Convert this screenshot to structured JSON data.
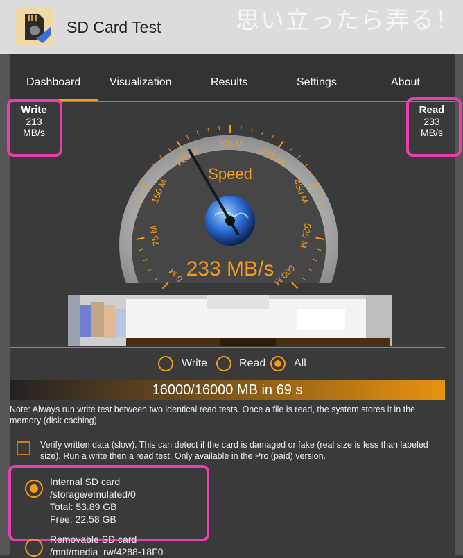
{
  "app": {
    "title": "SD Card Test",
    "watermark": "思い立ったら弄る！"
  },
  "tabs": [
    "Dashboard",
    "Visualization",
    "Results",
    "Settings",
    "About"
  ],
  "active_tab": "Dashboard",
  "write": {
    "label": "Write",
    "value": "213",
    "unit": "MB/s"
  },
  "read": {
    "label": "Read",
    "value": "233",
    "unit": "MB/s"
  },
  "gauge": {
    "label": "Speed",
    "readout": "233 MB/s",
    "ticks": [
      "0 M",
      "75 M",
      "150 M",
      "225 M",
      "300 M",
      "375 M",
      "450 M",
      "525 M",
      "600 M"
    ],
    "min": 0,
    "max": 600,
    "needle_value": 233
  },
  "mode": {
    "options": [
      "Write",
      "Read",
      "All"
    ],
    "selected": "All"
  },
  "progress": {
    "text": "16000/16000 MB in 69 s",
    "fraction": 1.0
  },
  "note": "Note: Always run write test between two identical read tests. Once a file is read, the system stores it in the memory (disk caching).",
  "verify": {
    "checked": false,
    "text": "Verify written data (slow). This can detect if the card is damaged or fake (real size is less than labeled size). Run a write then a read test. Only available in the Pro (paid) version."
  },
  "storage": [
    {
      "name": "Internal SD card",
      "path": "/storage/emulated/0",
      "total": "Total: 53.89 GB",
      "free": "Free: 22.58 GB",
      "selected": true
    },
    {
      "name": "Removable SD card",
      "path": "/mnt/media_rw/4288-18F0",
      "selected": false
    }
  ],
  "colors": {
    "accent": "#f59c1a",
    "highlight": "#e83fb0",
    "background": "#3a3a3a"
  },
  "icons": [
    "sd-card-icon",
    "globe-icon"
  ]
}
